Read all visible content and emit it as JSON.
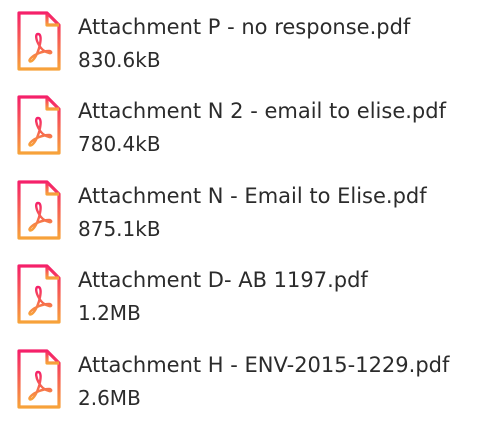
{
  "attachments": [
    {
      "name": "Attachment P - no response.pdf",
      "size": "830.6kB",
      "icon": "pdf-file-icon"
    },
    {
      "name": "Attachment N 2 - email to elise.pdf",
      "size": "780.4kB",
      "icon": "pdf-file-icon"
    },
    {
      "name": "Attachment N - Email to Elise.pdf",
      "size": "875.1kB",
      "icon": "pdf-file-icon"
    },
    {
      "name": "Attachment D- AB 1197.pdf",
      "size": "1.2MB",
      "icon": "pdf-file-icon"
    },
    {
      "name": "Attachment H - ENV-2015-1229.pdf",
      "size": "2.6MB",
      "icon": "pdf-file-icon"
    }
  ],
  "colors": {
    "icon_gradient_top": "#f5206a",
    "icon_gradient_bottom": "#f7a23a",
    "text": "#2b2b2b",
    "background": "#ffffff"
  }
}
